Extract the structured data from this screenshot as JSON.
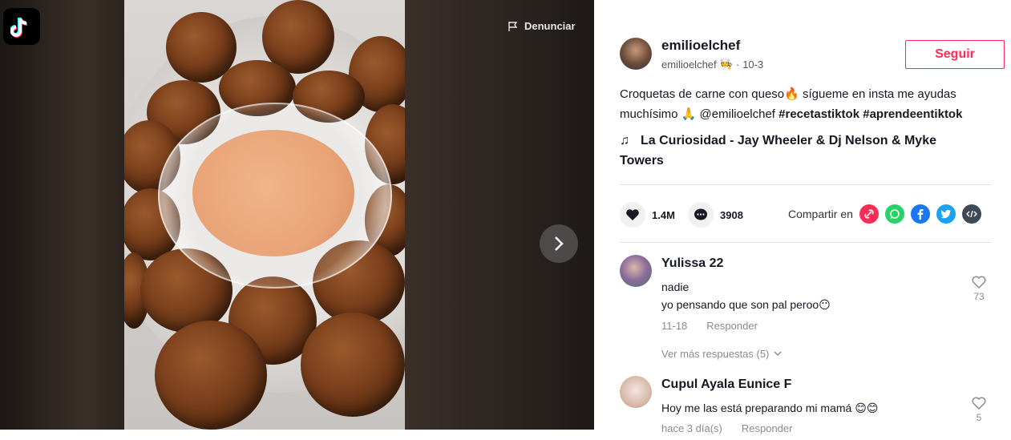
{
  "colors": {
    "accent": "#fe2c55",
    "text": "#161823",
    "muted": "#8a8b91"
  },
  "video": {
    "report_label": "Denunciar",
    "next_icon": "chevron-right-icon"
  },
  "author": {
    "username": "emilioelchef",
    "handle": "emilioelchef",
    "badge_emoji": "🧑‍🍳",
    "separator": "·",
    "date": "10-3",
    "follow_label": "Seguir"
  },
  "caption": {
    "text1": "Croquetas de carne con queso",
    "fire": "🔥",
    "text2": " sígueme en insta me ayudas muchísimo ",
    "pray": "🙏",
    "mention": " @emilioelchef ",
    "tag1": "#recetastiktok",
    "space": " ",
    "tag2": "#aprendeentiktok"
  },
  "music": {
    "note": "♫",
    "title": "La Curiosidad - Jay Wheeler & Dj Nelson & Myke Towers"
  },
  "stats": {
    "likes": "1.4M",
    "comments": "3908",
    "share_label": "Compartir en"
  },
  "share_icons": [
    "link-icon",
    "whatsapp-icon",
    "facebook-icon",
    "twitter-icon",
    "embed-icon"
  ],
  "comments": [
    {
      "name": "Yulissa 22",
      "line1": "nadie",
      "line2": "yo pensando que son pal peroo",
      "emoji": "😶",
      "date": "11-18",
      "reply": "Responder",
      "likes": "73"
    },
    {
      "name": "Cupul Ayala Eunice F",
      "line1": "Hoy me las está preparando mi mamá ",
      "emoji": "😊😊",
      "date": "hace 3 día(s)",
      "reply": "Responder",
      "likes": "5"
    }
  ],
  "more_replies": "Ver más respuestas (5)"
}
